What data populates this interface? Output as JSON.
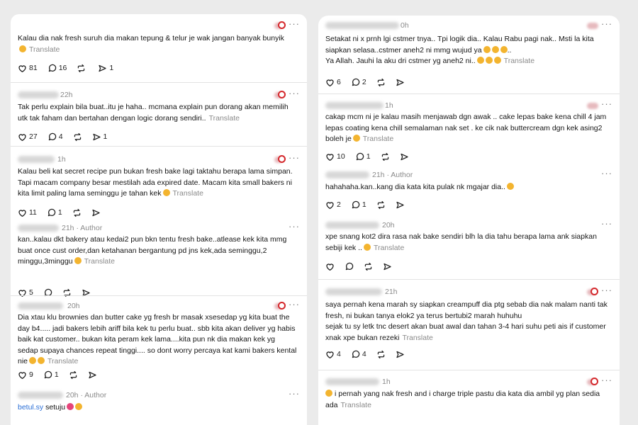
{
  "left": [
    {
      "time": "",
      "author": "",
      "text": "Kalau dia nak fresh suruh dia makan tepung & telur je wak jangan banyak bunyik",
      "emoji": true,
      "translate": "Translate",
      "likes": "81",
      "replies": "16",
      "reposts": "",
      "shares": "1"
    },
    {
      "time": "22h",
      "author": "",
      "text": "Tak perlu explain bila buat..itu je haha.. mcmana explain pun dorang akan memilih utk tak faham dan bertahan dengan logic dorang sendiri..",
      "emoji": false,
      "translate": "Translate",
      "likes": "27",
      "replies": "4",
      "reposts": "",
      "shares": "1"
    },
    {
      "time": "1h",
      "author": "",
      "text": "Kalau beli kat secret recipe pun bukan fresh bake lagi taktahu berapa lama simpan. Tapi macam company besar mestilah ada expired date. Macam kita small bakers ni kita limit paling lama seminggu je tahan kek",
      "emoji": true,
      "translate": "Translate",
      "likes": "11",
      "replies": "1",
      "reposts": "",
      "shares": ""
    },
    {
      "time": "21h",
      "author": "Author",
      "text": "kan..kalau dkt bakery atau kedai2 pun bkn tentu fresh bake..atlease kek kita mmg buat once cust order,dan ketahanan bergantung pd jns kek,ada seminggu,2 minggu,3minggu",
      "emoji": true,
      "translate": "Translate",
      "likes": "5",
      "replies": "",
      "reposts": "",
      "shares": ""
    },
    {
      "time": "20h",
      "author": "",
      "text": "Dia xtau klu brownies dan butter cake yg fresh br masak xsesedap yg kita buat the day b4..... jadi bakers lebih ariff bila kek tu perlu buat.. sbb kita akan deliver yg habis baik kat customer.. bukan kita peram kek lama....kita pun nk dia makan kek yg sedap supaya chances repeat tinggi.... so dont worry percaya kat kami bakers kental nie",
      "emoji": true,
      "translate": "Translate",
      "likes": "9",
      "replies": "1",
      "reposts": "",
      "shares": ""
    },
    {
      "time": "20h",
      "author": "Author",
      "link": "betul.sy",
      "text": "setuju",
      "emoji": true,
      "translate": "",
      "likes": "",
      "replies": "",
      "reposts": "",
      "shares": ""
    }
  ],
  "right": [
    {
      "time": "0h",
      "author": "",
      "text": "Setakat ni x prnh lgi cstmer tnya.. Tpi logik dia.. Kalau Rabu pagi nak.. Msti la kita siapkan selasa..cstmer aneh2 ni mmg wujud ya",
      "text2": "Ya Allah. Jauhi la aku dri cstmer yg aneh2 ni..",
      "emoji": true,
      "translate": "Translate",
      "likes": "6",
      "replies": "2",
      "reposts": "",
      "shares": ""
    },
    {
      "time": "1h",
      "author": "",
      "text": "cakap mcm ni je kalau masih menjawab dgn awak .. cake lepas bake kena chill 4 jam lepas coating kena chill semalaman nak set . ke cik nak buttercream dgn kek asing2 boleh je",
      "emoji": true,
      "translate": "Translate",
      "likes": "10",
      "replies": "1",
      "reposts": "",
      "shares": ""
    },
    {
      "time": "21h",
      "author": "Author",
      "text": "hahahaha.kan..kang dia kata kita pulak nk mgajar dia..",
      "emoji": true,
      "translate": "",
      "likes": "2",
      "replies": "1",
      "reposts": "",
      "shares": ""
    },
    {
      "time": "20h",
      "author": "",
      "text": "xpe snang kot2 dira rasa nak bake sendiri blh la dia tahu berapa lama ank siapkan sebiji kek ..",
      "emoji": true,
      "translate": "Translate",
      "likes": "",
      "replies": "",
      "reposts": "",
      "shares": ""
    },
    {
      "time": "21h",
      "author": "",
      "text": "saya pernah kena marah sy siapkan creampuff dia ptg sebab dia nak malam nanti tak fresh, ni bukan tanya elok2 ya terus bertubi2 marah huhuhu",
      "text2": "sejak tu sy letk tnc desert akan buat awal dan tahan 3-4 hari suhu peti ais if customer xnak xpe bukan rezeki",
      "emoji": false,
      "translate": "Translate",
      "likes": "4",
      "replies": "4",
      "reposts": "",
      "shares": ""
    },
    {
      "time": "1h",
      "author": "",
      "text": "i pernah yang nak fresh and i charge triple pastu dia kata dia ambil yg plan sedia ada",
      "emoji": true,
      "translate": "Translate",
      "likes": "",
      "replies": "",
      "reposts": "",
      "shares": ""
    }
  ]
}
